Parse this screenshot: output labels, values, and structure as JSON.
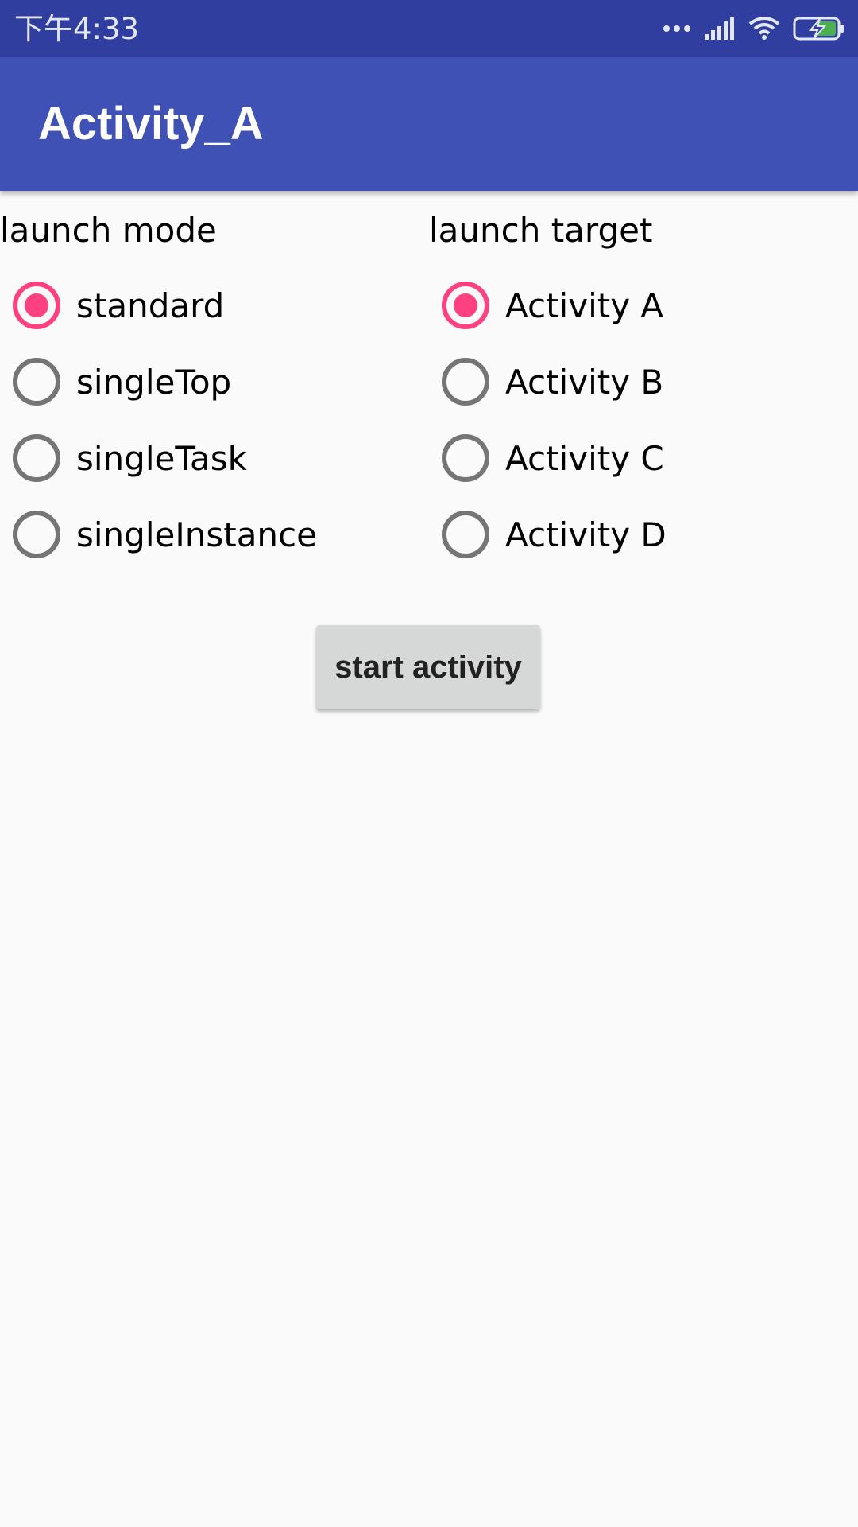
{
  "status_bar": {
    "time": "下午4:33",
    "icons": [
      "more-dots-icon",
      "signal-icon",
      "wifi-icon",
      "battery-charging-icon"
    ],
    "background": "#303f9f"
  },
  "app_bar": {
    "title": "Activity_A",
    "background": "#3f51b5"
  },
  "launch_mode": {
    "heading": "launch mode",
    "options": [
      {
        "label": "standard",
        "checked": true
      },
      {
        "label": "singleTop",
        "checked": false
      },
      {
        "label": "singleTask",
        "checked": false
      },
      {
        "label": "singleInstance",
        "checked": false
      }
    ]
  },
  "launch_target": {
    "heading": "launch target",
    "options": [
      {
        "label": "Activity A",
        "checked": true
      },
      {
        "label": "Activity B",
        "checked": false
      },
      {
        "label": "Activity C",
        "checked": false
      },
      {
        "label": "Activity D",
        "checked": false
      }
    ]
  },
  "start_button": {
    "label": "start activity"
  },
  "colors": {
    "accent": "#ff4081",
    "radio_unchecked": "#757575",
    "button_bg": "#d6d7d7",
    "page_bg": "#fafafa"
  }
}
